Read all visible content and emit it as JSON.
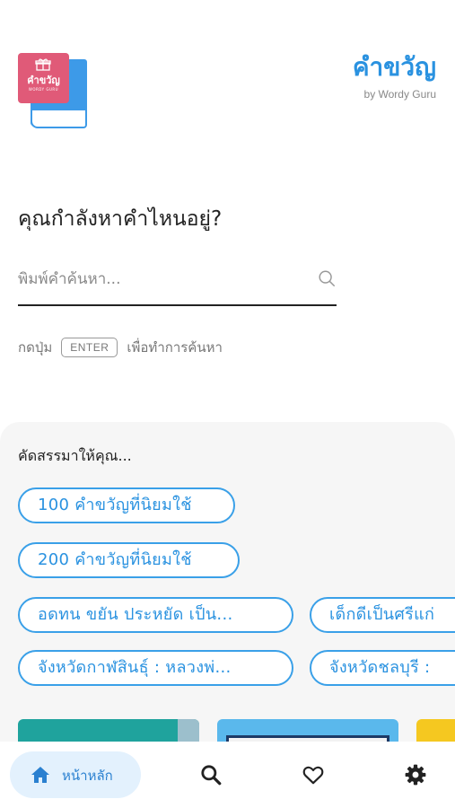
{
  "header": {
    "logo_title": "คำขวัญ",
    "logo_subtitle": "WORDY GURU",
    "brand_title": "คำขวัญ",
    "brand_subtitle": "by Wordy Guru"
  },
  "search": {
    "question": "คุณกำลังหาคำไหนอยู่?",
    "placeholder": "พิมพ์คำค้นหา...",
    "value": "",
    "hint_before": "กดปุ่ม",
    "hint_key": "ENTER",
    "hint_after": "เพื่อทำการค้นหา"
  },
  "recommend": {
    "title": "คัดสรรมาให้คุณ...",
    "chips": [
      "100 คำขวัญที่นิยมใช้",
      "200 คำขวัญที่นิยมใช้",
      "อดทน ขยัน ประหยัด เป็น...",
      "เด็กดีเป็นศรีแก่",
      "จังหวัดกาฬสินธุ์ : หลวงพ่...",
      "จังหวัดชลบุรี :"
    ]
  },
  "nav": {
    "home_label": "หน้าหลัก",
    "items": [
      "home-icon",
      "search-icon",
      "heart-icon",
      "gear-icon"
    ]
  },
  "colors": {
    "accent": "#2a92e0",
    "chip_border": "#3aa0e8",
    "logo_pink": "#e05a78",
    "panel_bg": "#f6f6f6",
    "nav_active_bg": "#e3f1fd"
  }
}
